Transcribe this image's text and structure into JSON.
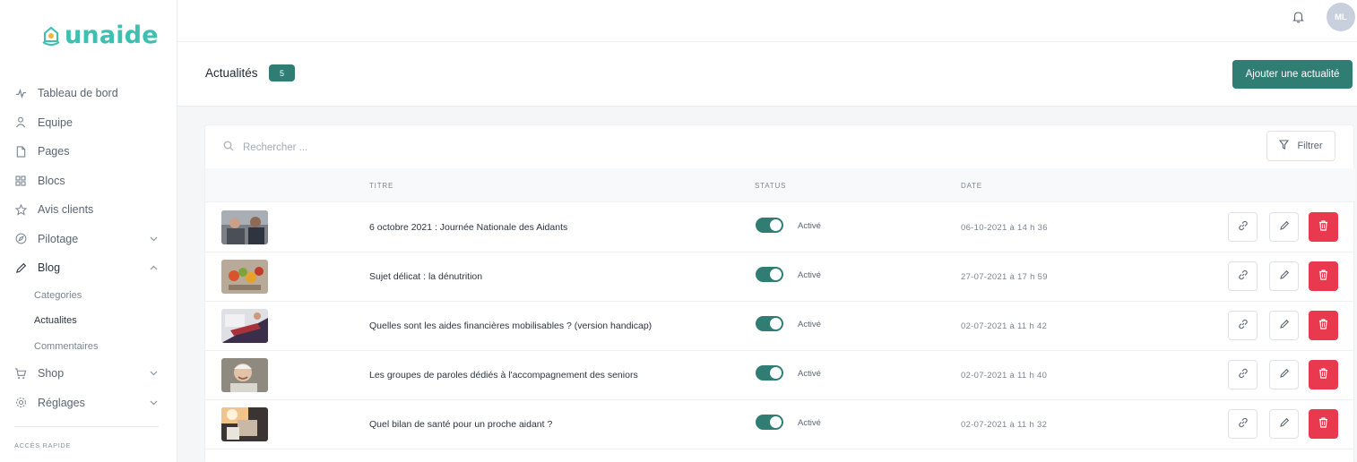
{
  "brand": {
    "name": "unaide",
    "accent": "#3fbfb0"
  },
  "sidebar": {
    "items": [
      {
        "label": "Tableau de bord",
        "icon": "activity-icon"
      },
      {
        "label": "Equipe",
        "icon": "user-icon"
      },
      {
        "label": "Pages",
        "icon": "file-icon"
      },
      {
        "label": "Blocs",
        "icon": "grid-icon"
      },
      {
        "label": "Avis clients",
        "icon": "star-icon"
      },
      {
        "label": "Pilotage",
        "icon": "compass-icon"
      },
      {
        "label": "Blog",
        "icon": "pen-icon"
      },
      {
        "label": "Shop",
        "icon": "cart-icon"
      },
      {
        "label": "Réglages",
        "icon": "gear-icon"
      }
    ],
    "blog_sub": [
      "Categories",
      "Actualites",
      "Commentaires"
    ],
    "quick_access": "ACCÈS RAPIDE"
  },
  "topbar": {
    "avatar_initials": "ML"
  },
  "header": {
    "title": "Actualités",
    "count": "5",
    "add_label": "Ajouter une actualité"
  },
  "search": {
    "placeholder": "Rechercher ..."
  },
  "filter": {
    "label": "Filtrer"
  },
  "table": {
    "columns": {
      "title": "TITRE",
      "status": "STATUS",
      "date": "DATE"
    },
    "rows": [
      {
        "title": "6 octobre 2021 : Journée Nationale des Aidants",
        "status": "Activé",
        "date": "06-10-2021 à 14 h 36"
      },
      {
        "title": "Sujet délicat : la dénutrition",
        "status": "Activé",
        "date": "27-07-2021 à 17 h 59"
      },
      {
        "title": "Quelles sont les aides financières mobilisables ? (version handicap)",
        "status": "Activé",
        "date": "02-07-2021 à 11 h 42"
      },
      {
        "title": "Les groupes de paroles dédiés à l'accompagnement des seniors",
        "status": "Activé",
        "date": "02-07-2021 à 11 h 40"
      },
      {
        "title": "Quel bilan de santé pour un proche aidant ?",
        "status": "Activé",
        "date": "02-07-2021 à 11 h 32"
      }
    ]
  },
  "colors": {
    "primary": "#2f7d73",
    "danger": "#e8394f"
  }
}
